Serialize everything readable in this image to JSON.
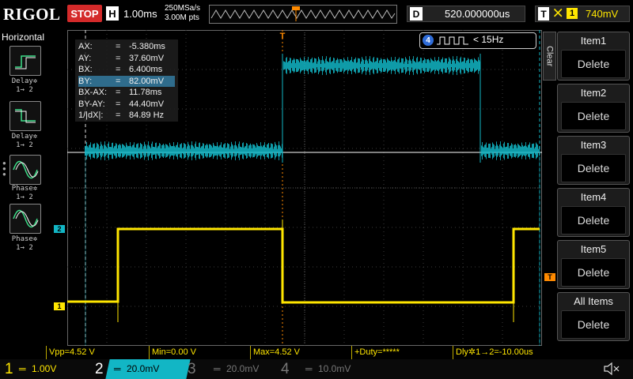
{
  "topbar": {
    "brand": "RIGOL",
    "run_state": "STOP",
    "horizontal_label": "H",
    "timebase": "1.00ms",
    "sample_rate": "250MSa/s",
    "points": "3.00M pts",
    "delay_label": "D",
    "delay_value": "520.000000us",
    "trigger_label": "T",
    "trigger_source": "1",
    "trigger_level": "740mV"
  },
  "left_menu": {
    "title": "Horizontal",
    "items": [
      {
        "caption_1": "Delay✲",
        "caption_2": "1→ 2",
        "icon": "delay-rise-icon"
      },
      {
        "caption_1": "Delay✲",
        "caption_2": "1→ 2",
        "icon": "delay-fall-icon"
      },
      {
        "caption_1": "Phase✲",
        "caption_2": "1→ 2",
        "icon": "phase-sine-icon"
      },
      {
        "caption_1": "Phase✲",
        "caption_2": "1→ 2",
        "icon": "phase-sine-icon"
      }
    ]
  },
  "cursor_readout": {
    "rows": [
      {
        "key": "AX:",
        "eq": "=",
        "value": "-5.380ms"
      },
      {
        "key": "AY:",
        "eq": "=",
        "value": "37.60mV"
      },
      {
        "key": "BX:",
        "eq": "=",
        "value": "6.400ms"
      },
      {
        "key": "BY:",
        "eq": "=",
        "value": "82.00mV"
      },
      {
        "key": "BX-AX:",
        "eq": "=",
        "value": "11.78ms"
      },
      {
        "key": "BY-AY:",
        "eq": "=",
        "value": "44.40mV"
      },
      {
        "key": "1/|dX|:",
        "eq": "=",
        "value": "84.89 Hz"
      }
    ],
    "selected_row": 3
  },
  "ch4_indicator": {
    "channel": "4",
    "freq": "< 15Hz"
  },
  "right_menu": {
    "clear_label": "Clear",
    "items": [
      {
        "title": "Item1",
        "button": "Delete"
      },
      {
        "title": "Item2",
        "button": "Delete"
      },
      {
        "title": "Item3",
        "button": "Delete"
      },
      {
        "title": "Item4",
        "button": "Delete"
      },
      {
        "title": "Item5",
        "button": "Delete"
      },
      {
        "title": "All Items",
        "button": "Delete"
      }
    ]
  },
  "measurements": [
    "Vpp=4.52 V",
    "Min=0.00 V",
    "Max=4.52 V",
    "+Duty=*****",
    "Dly✲1→2=-10.00us"
  ],
  "channels": [
    {
      "num": "1",
      "scale": "1.00V",
      "color": "#ffe600"
    },
    {
      "num": "2",
      "scale": "20.0mV",
      "color": "#12b6c5"
    },
    {
      "num": "3",
      "scale": "20.0mV",
      "color": "#c43ae0"
    },
    {
      "num": "4",
      "scale": "10.0mV",
      "color": "#2f6cd8"
    }
  ],
  "markers": {
    "ch1": "1",
    "ch2": "2",
    "trigger": "T"
  },
  "colors": {
    "ch1": "#ffe600",
    "ch2": "#12b6c5",
    "grid": "#3a3a3a",
    "trigger": "#ff8a00"
  }
}
